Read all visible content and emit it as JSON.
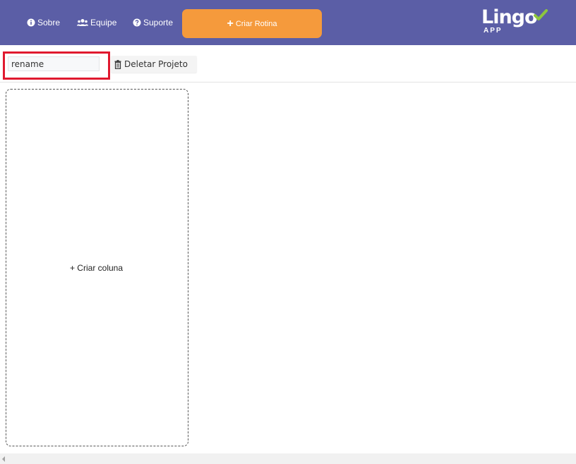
{
  "header": {
    "nav": {
      "about_label": "Sobre",
      "team_label": "Equipe",
      "support_label": "Suporte"
    },
    "create_routine_label": "Criar Rotina",
    "logo_text": "Lingo",
    "logo_sub": "APP"
  },
  "toolbar": {
    "project_name_value": "rename",
    "delete_project_label": "Deletar Projeto"
  },
  "board": {
    "create_column_label": "+ Criar coluna"
  },
  "colors": {
    "header_bg": "#5b5ea6",
    "accent_orange": "#f59a3c",
    "highlight_red": "#e0192f",
    "logo_check": "#8dc63f"
  },
  "icons": {
    "about": "info-circle-icon",
    "team": "users-icon",
    "support": "question-circle-icon",
    "create": "plus-icon",
    "delete": "trash-icon"
  }
}
